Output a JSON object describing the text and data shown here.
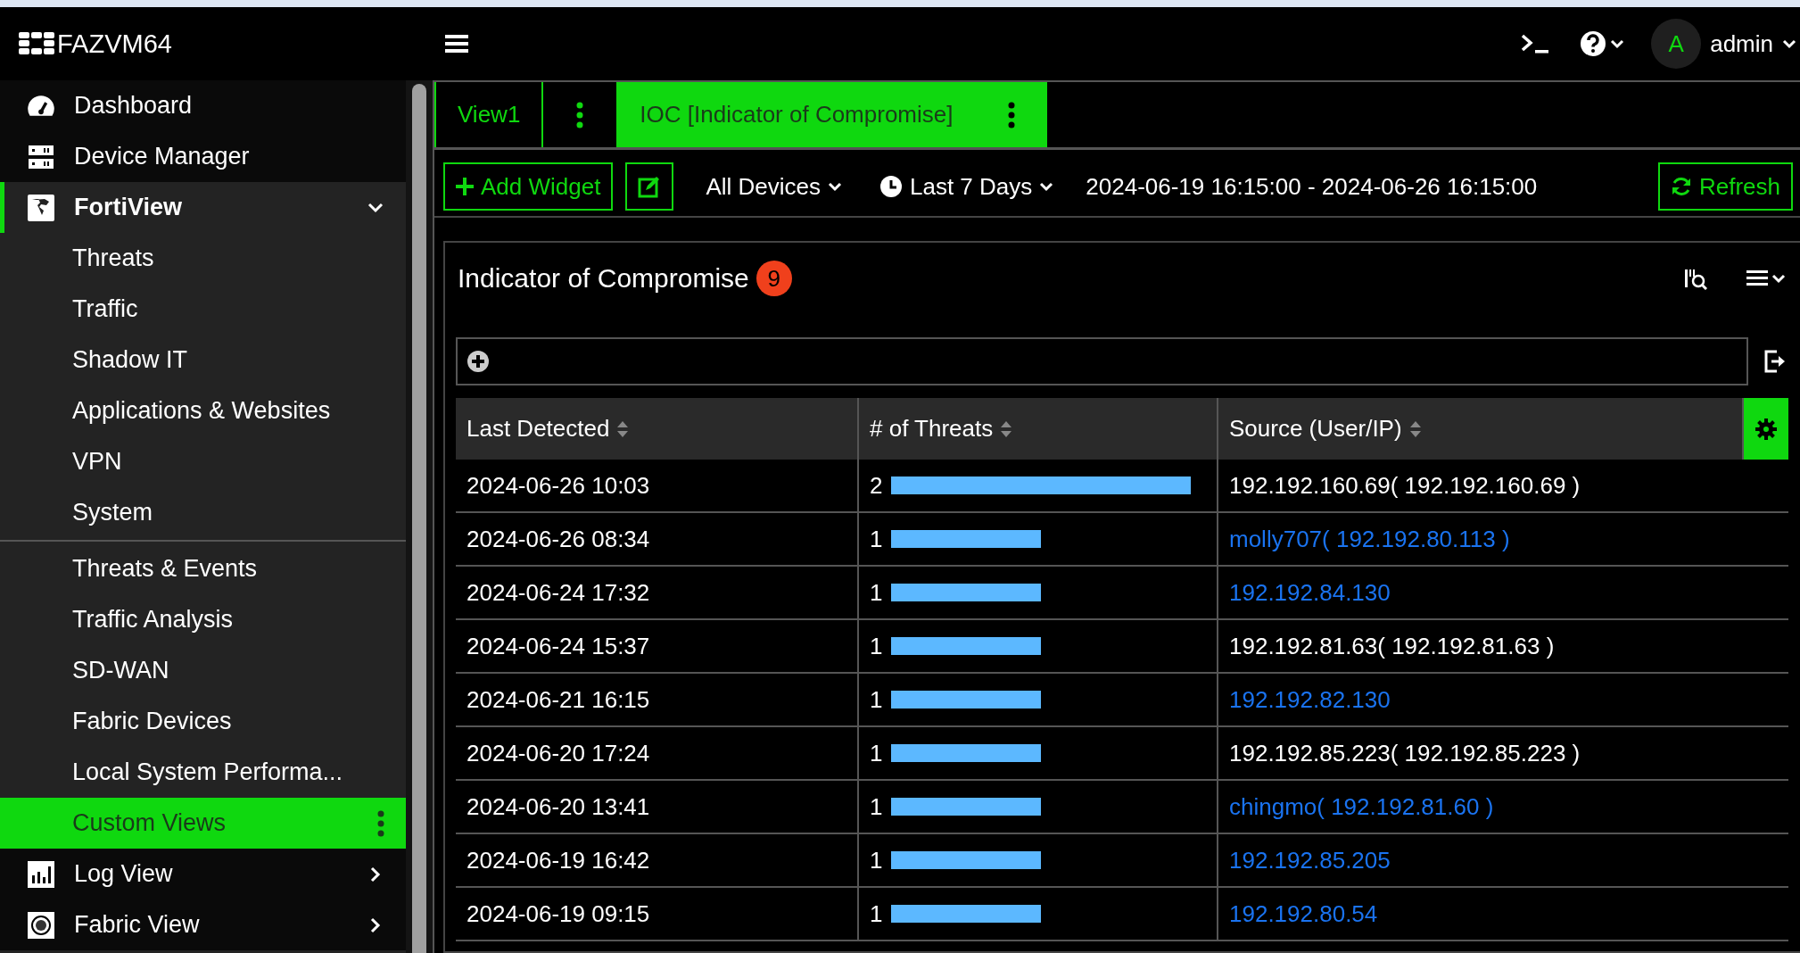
{
  "header": {
    "logo": "FAZVM64",
    "user": {
      "initial": "A",
      "name": "admin"
    }
  },
  "sidebar": {
    "items": [
      {
        "label": "Dashboard",
        "selected": false
      },
      {
        "label": "Device Manager",
        "selected": false
      },
      {
        "label": "FortiView",
        "selected": true,
        "expanded": true,
        "sections": [
          {
            "items": [
              {
                "label": "Threats",
                "selected": false
              },
              {
                "label": "Traffic",
                "selected": false
              },
              {
                "label": "Shadow IT",
                "selected": false
              },
              {
                "label": "Applications & Websites",
                "selected": false
              },
              {
                "label": "VPN",
                "selected": false
              },
              {
                "label": "System",
                "selected": false
              }
            ]
          },
          {
            "items": [
              {
                "label": "Threats & Events",
                "selected": false
              },
              {
                "label": "Traffic Analysis",
                "selected": false
              },
              {
                "label": "SD-WAN",
                "selected": false
              },
              {
                "label": "Fabric Devices",
                "selected": false
              },
              {
                "label": "Local System Performa...",
                "selected": false
              },
              {
                "label": "Custom Views",
                "selected": true
              }
            ]
          }
        ]
      },
      {
        "label": "Log View",
        "selected": false,
        "expanded": false
      },
      {
        "label": "Fabric View",
        "selected": false,
        "expanded": false
      }
    ]
  },
  "tabs": [
    {
      "label": "View1",
      "selected": false
    },
    {
      "label": "IOC [Indicator of Compromise]",
      "selected": true
    }
  ],
  "toolbar": {
    "add_widget": "Add Widget",
    "devices": "All Devices",
    "time_range": "Last 7 Days",
    "date_range": "2024-06-19 16:15:00 - 2024-06-26 16:15:00",
    "refresh": "Refresh"
  },
  "widget": {
    "title": "Indicator of Compromise",
    "badge": "9",
    "table": {
      "columns": [
        "Last Detected",
        "# of Threats",
        "Source (User/IP)"
      ],
      "rows": [
        {
          "last_detected": "2024-06-26 10:03",
          "threats": "2",
          "source": "192.192.160.69( 192.192.160.69 )",
          "link": false
        },
        {
          "last_detected": "2024-06-26 08:34",
          "threats": "1",
          "source": "molly707( 192.192.80.113 )",
          "link": true
        },
        {
          "last_detected": "2024-06-24 17:32",
          "threats": "1",
          "source": "192.192.84.130",
          "link": true
        },
        {
          "last_detected": "2024-06-24 15:37",
          "threats": "1",
          "source": "192.192.81.63( 192.192.81.63 )",
          "link": false
        },
        {
          "last_detected": "2024-06-21 16:15",
          "threats": "1",
          "source": "192.192.82.130",
          "link": true
        },
        {
          "last_detected": "2024-06-20 17:24",
          "threats": "1",
          "source": "192.192.85.223( 192.192.85.223 )",
          "link": false
        },
        {
          "last_detected": "2024-06-20 13:41",
          "threats": "1",
          "source": "chingmo( 192.192.81.60 )",
          "link": true
        },
        {
          "last_detected": "2024-06-19 16:42",
          "threats": "1",
          "source": "192.192.85.205",
          "link": true
        },
        {
          "last_detected": "2024-06-19 09:15",
          "threats": "1",
          "source": "192.192.80.54",
          "link": true
        }
      ]
    }
  }
}
